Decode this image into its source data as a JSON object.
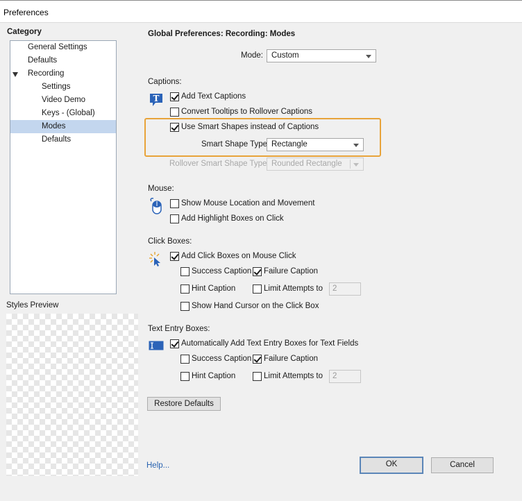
{
  "window": {
    "title": "Preferences"
  },
  "sidebar": {
    "heading": "Category",
    "items": [
      {
        "label": "General Settings"
      },
      {
        "label": "Defaults"
      },
      {
        "label": "Recording"
      },
      {
        "label": "Settings"
      },
      {
        "label": "Video Demo"
      },
      {
        "label": "Keys - (Global)"
      },
      {
        "label": "Modes"
      },
      {
        "label": "Defaults"
      }
    ],
    "selected": "Modes",
    "styles_preview_label": "Styles Preview"
  },
  "main": {
    "title": "Global Preferences: Recording: Modes",
    "mode": {
      "label": "Mode:",
      "value": "Custom"
    },
    "captions": {
      "heading": "Captions:",
      "add_text_captions": {
        "label": "Add Text Captions",
        "checked": true
      },
      "convert_tooltips": {
        "label": "Convert Tooltips to Rollover Captions",
        "checked": false
      },
      "use_smart_shapes": {
        "label": "Use Smart Shapes instead of Captions",
        "checked": true
      },
      "smart_shape_type": {
        "label": "Smart Shape Type",
        "value": "Rectangle"
      },
      "rollover_smart_shape_type": {
        "label": "Rollover Smart Shape Type",
        "value": "Rounded Rectangle"
      }
    },
    "mouse": {
      "heading": "Mouse:",
      "show_mouse_location": {
        "label": "Show Mouse Location and Movement",
        "checked": false
      },
      "add_highlight_boxes": {
        "label": "Add Highlight Boxes on Click",
        "checked": false
      }
    },
    "click_boxes": {
      "heading": "Click Boxes:",
      "add_click_boxes": {
        "label": "Add Click Boxes on Mouse Click",
        "checked": true
      },
      "success_caption": {
        "label": "Success Caption",
        "checked": false
      },
      "failure_caption": {
        "label": "Failure Caption",
        "checked": true
      },
      "hint_caption": {
        "label": "Hint Caption",
        "checked": false
      },
      "limit_attempts": {
        "label": "Limit Attempts to",
        "checked": false,
        "value": "2"
      },
      "show_hand_cursor": {
        "label": "Show Hand Cursor on the Click Box",
        "checked": false
      }
    },
    "text_entry_boxes": {
      "heading": "Text Entry Boxes:",
      "auto_add": {
        "label": "Automatically Add Text Entry Boxes for Text Fields",
        "checked": true
      },
      "success_caption": {
        "label": "Success Caption",
        "checked": false
      },
      "failure_caption": {
        "label": "Failure Caption",
        "checked": true
      },
      "hint_caption": {
        "label": "Hint Caption",
        "checked": false
      },
      "limit_attempts": {
        "label": "Limit Attempts to",
        "checked": false,
        "value": "2"
      }
    },
    "restore_defaults": "Restore Defaults"
  },
  "footer": {
    "help": "Help...",
    "ok": "OK",
    "cancel": "Cancel"
  },
  "colors": {
    "highlight_border": "#e8a33a",
    "selection": "#c3d6ee",
    "link": "#2b64b1"
  }
}
